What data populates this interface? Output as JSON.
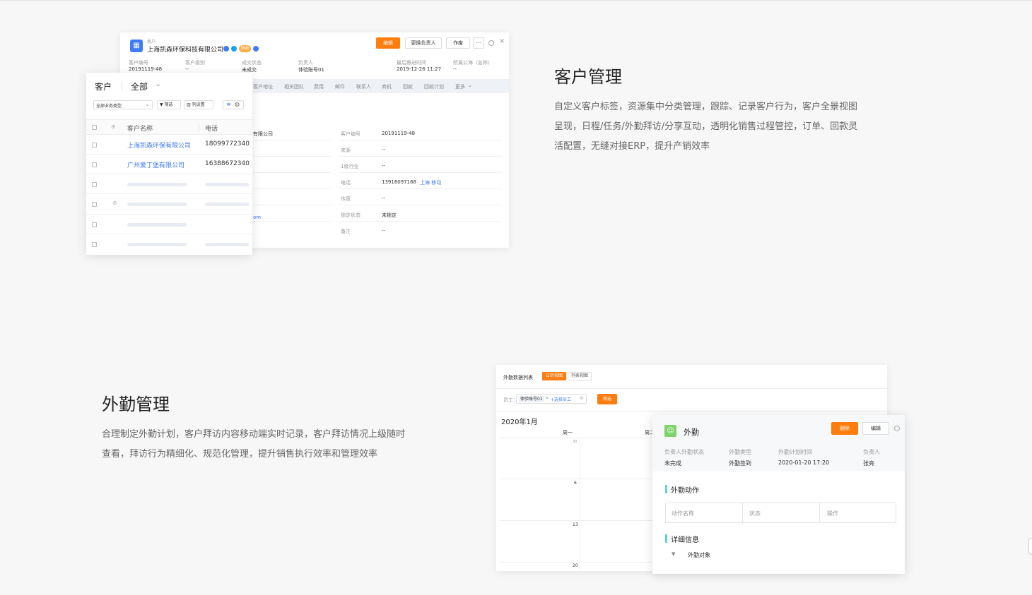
{
  "customer_detail": {
    "breadcrumb": "客户",
    "company_name": "上海凯森环保科技有限公司",
    "badge_label": "回收",
    "buttons": {
      "edit": "编辑",
      "change_owner": "更换负责人",
      "void": "作废",
      "more": "···"
    },
    "summary": [
      {
        "label": "客户编号",
        "value": "20191119-48"
      },
      {
        "label": "客户级别",
        "value": "--"
      },
      {
        "label": "成交状态",
        "value": "未成交"
      },
      {
        "label": "负责人",
        "value": "体验账号01"
      },
      {
        "label": "最后跟进时间",
        "value": "2019-12-26 11:27"
      },
      {
        "label": "所属公海（名称）",
        "value": "--"
      }
    ],
    "tabs": [
      "客户地址",
      "相关团队",
      "费用",
      "邮件",
      "联系人",
      "商机",
      "回款",
      "回款计划",
      "更多"
    ],
    "left_partial": [
      "有限公司",
      "om"
    ],
    "fields": [
      {
        "label": "客户编号",
        "value": "20191119-48"
      },
      {
        "label": "来源",
        "value": "--"
      },
      {
        "label": "1级行业",
        "value": "--"
      },
      {
        "label": "电话",
        "value": "13916097168",
        "extra": "上海 移动"
      },
      {
        "label": "传真",
        "value": "--"
      },
      {
        "label": "锁定状态",
        "value": "未锁定"
      },
      {
        "label": "备注",
        "value": "--"
      }
    ]
  },
  "customer_list": {
    "title": "客户",
    "scope": "全部",
    "type_filter": "全部业务类型",
    "filter_button": "筛选",
    "column_button": "列设置",
    "columns": {
      "name": "客户名称",
      "phone": "电话"
    },
    "rows": [
      {
        "name": "上海凯森环保有限公司",
        "phone": "18099772340"
      },
      {
        "name": "广州爱丁堡有限公司",
        "phone": "16388672340"
      }
    ]
  },
  "section_customer": {
    "title": "客户管理",
    "desc_lines": [
      "自定义客户标签，资源集中分类管理，跟踪、记录客户行为，客户全景视图",
      "呈现，日程/任务/外勤拜访/分享互动，透明化销售过程管控，订单、回款灵",
      "活配置，无缝对接ERP，提升产销效率"
    ]
  },
  "section_field": {
    "title": "外勤管理",
    "desc_lines": [
      "合理制定外勤计划，客户拜访内容移动端实时记录，客户拜访情况上级随时",
      "查看，拜访行为精细化、规范化管理，提升销售执行效率和管理效率"
    ]
  },
  "field_list": {
    "title": "外勤数据列表",
    "tab_calendar": "日历视图",
    "tab_list": "列表视图",
    "staff_label": "员工：",
    "staff_tag": "体验账号01",
    "select_staff": "+选择员工",
    "filter_button": "筛选",
    "month": "2020年1月",
    "weekdays": [
      "周一",
      "周二"
    ],
    "dates": [
      "30",
      "6",
      "13",
      "20"
    ]
  },
  "field_detail": {
    "title": "外勤",
    "delete_button": "删除",
    "edit_button": "编辑",
    "info": [
      {
        "label": "负责人外勤状态",
        "value": "未完成"
      },
      {
        "label": "外勤类型",
        "value": "外勤签到"
      },
      {
        "label": "外勤计划时间",
        "value": "2020-01-20 17:20"
      },
      {
        "label": "负责人",
        "value": "张亮"
      }
    ],
    "actions_heading": "外勤动作",
    "action_columns": [
      "动作名称",
      "状态",
      "操作"
    ],
    "details_heading": "详细信息",
    "target_label": "外勤对象"
  },
  "colors": {
    "accent_orange": "#ff7d0f",
    "accent_blue": "#3e7bfa",
    "heading_bar": "#5ad2e0"
  }
}
